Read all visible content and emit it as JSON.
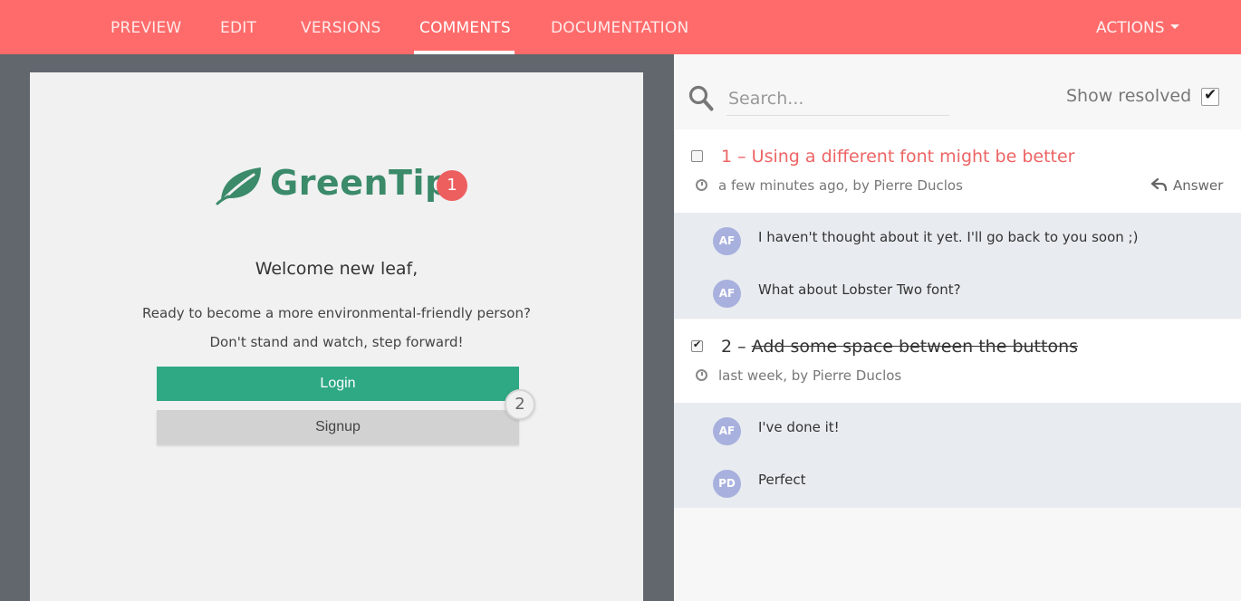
{
  "nav": {
    "tabs": [
      {
        "label": "PREVIEW"
      },
      {
        "label": "EDIT"
      },
      {
        "label": "VERSIONS"
      },
      {
        "label": "COMMENTS"
      },
      {
        "label": "DOCUMENTATION"
      }
    ],
    "active_tab": "COMMENTS",
    "actions_label": "ACTIONS"
  },
  "colors": {
    "topbar": "#ff6b6b",
    "brand_green": "#3b8a6a",
    "login_button": "#2fa884",
    "pin_red": "#ed5f5f",
    "unresolved_title": "#ed6464",
    "avatar": "#a8b0de"
  },
  "preview": {
    "logo_text": "GreenTip",
    "logo_icon": "leaf-icon",
    "welcome": "Welcome new leaf,",
    "line1": "Ready to become a more environmental-friendly person?",
    "line2": "Don't stand and watch, step forward!",
    "login_label": "Login",
    "signup_label": "Signup",
    "pins": [
      "1",
      "2"
    ]
  },
  "comments": {
    "search_placeholder": "Search...",
    "show_resolved_label": "Show resolved",
    "show_resolved_checked": true,
    "threads": [
      {
        "number": "1",
        "title": "1 – Using a different font might be better",
        "meta": "a few minutes ago, by Pierre Duclos",
        "resolved": false,
        "answer_label": "Answer",
        "replies": [
          {
            "initials": "AF",
            "text": "I haven't thought about it yet. I'll go back to you soon ;)"
          },
          {
            "initials": "AF",
            "text": "What about Lobster Two font?"
          }
        ]
      },
      {
        "number": "2",
        "num_prefix": "2 – ",
        "title_text": "Add some space between the buttons",
        "meta": "last week, by Pierre Duclos",
        "resolved": true,
        "replies": [
          {
            "initials": "AF",
            "text": "I've done it!"
          },
          {
            "initials": "PD",
            "text": "Perfect"
          }
        ]
      }
    ]
  }
}
